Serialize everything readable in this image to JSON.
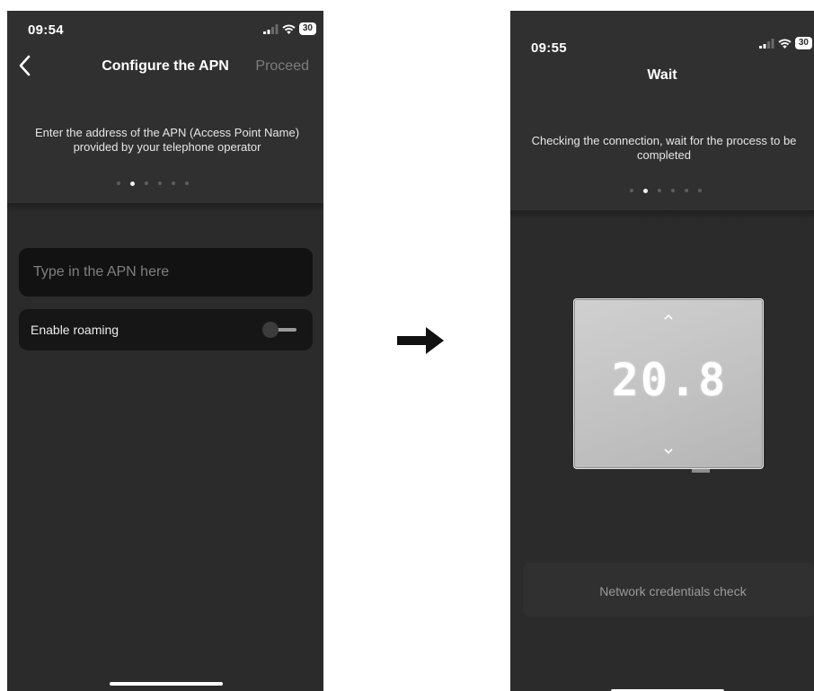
{
  "left_screen": {
    "status_time": "09:54",
    "battery": "30",
    "title": "Configure the APN",
    "proceed_label": "Proceed",
    "instruction": "Enter the address of the APN (Access Point Name) provided by your telephone operator",
    "step_dots": {
      "total": 6,
      "active_index": 1
    },
    "apn_input": {
      "placeholder": "Type in the APN here",
      "value": ""
    },
    "roaming": {
      "label": "Enable roaming",
      "enabled": false
    }
  },
  "right_screen": {
    "status_time": "09:55",
    "battery": "30",
    "title": "Wait",
    "instruction": "Checking the connection, wait for the process to be completed",
    "step_dots": {
      "total": 6,
      "active_index": 1
    },
    "thermostat": {
      "display": "20.8"
    },
    "status_message": "Network credentials check"
  },
  "icons": {
    "back": "chevron-left-icon",
    "signal": "signal-bars-icon",
    "wifi": "wifi-icon",
    "battery": "battery-icon",
    "arrow": "arrow-right-icon"
  },
  "colors": {
    "screen_background": "#2b2b2b",
    "header_background": "#303030",
    "input_background": "#121212",
    "muted_text": "#7d7d7d"
  }
}
